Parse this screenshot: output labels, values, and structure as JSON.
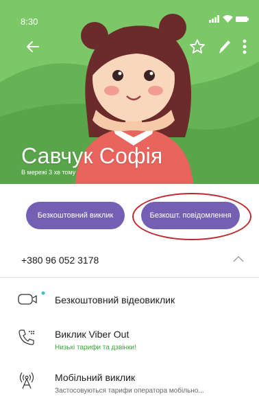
{
  "status_bar": {
    "time": "8:30"
  },
  "header": {
    "contact_name": "Савчук Софія",
    "contact_status": "В мережі 3 хв тому",
    "background_color": "#6dbb5c"
  },
  "actions": {
    "free_call_label": "Безкоштовний виклик",
    "free_message_label": "Безкошт. повідомлення",
    "button_color": "#7360b2"
  },
  "phone": {
    "number": "+380 96 052 3178"
  },
  "call_options": [
    {
      "title": "Безкоштовний відеовиклик",
      "subtitle": "",
      "icon": "video-camera-icon"
    },
    {
      "title": "Виклик Viber Out",
      "subtitle": "Низькі тарифи та дзвінки!",
      "subtitle_color": "#3aa53a",
      "icon": "viber-out-phone-icon"
    },
    {
      "title": "Мобільний виклик",
      "subtitle": "Застосовуються тарифи оператора мобільно...",
      "subtitle_color": "#666666",
      "icon": "cellular-tower-icon"
    }
  ]
}
